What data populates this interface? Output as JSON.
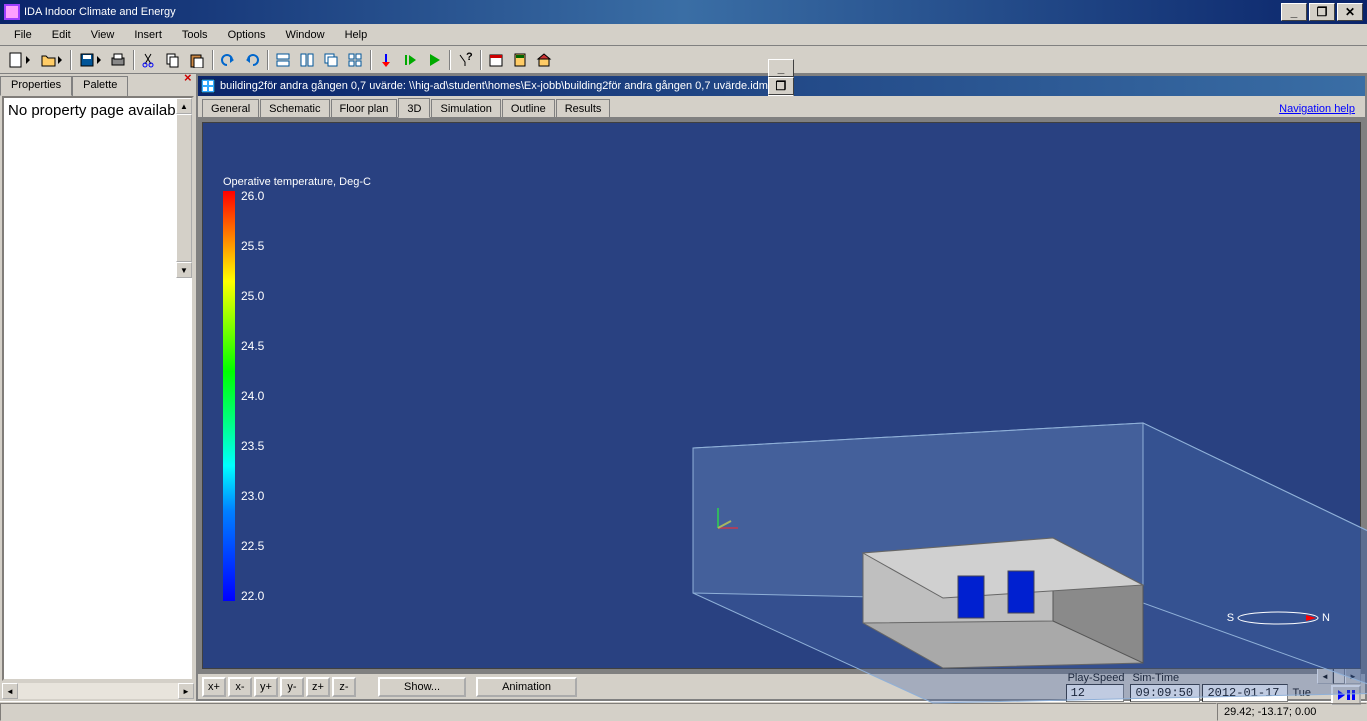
{
  "app": {
    "title": "IDA Indoor Climate and Energy"
  },
  "menu": {
    "file": "File",
    "edit": "Edit",
    "view": "View",
    "insert": "Insert",
    "tools": "Tools",
    "options": "Options",
    "window": "Window",
    "help": "Help"
  },
  "sidebar": {
    "tab_properties": "Properties",
    "tab_palette": "Palette",
    "body": "No property page available"
  },
  "doc": {
    "title": "building2för andra gången 0,7 uvärde: \\\\hig-ad\\student\\homes\\Ex-jobb\\building2för andra gången 0,7 uvärde.idm",
    "tabs": {
      "general": "General",
      "schematic": "Schematic",
      "floorplan": "Floor plan",
      "d3": "3D",
      "simulation": "Simulation",
      "outline": "Outline",
      "results": "Results"
    },
    "navhelp": "Navigation help"
  },
  "legend": {
    "title": "Operative temperature, Deg-C",
    "ticks": [
      "26.0",
      "25.5",
      "25.0",
      "24.5",
      "24.0",
      "23.5",
      "23.0",
      "22.5",
      "22.0"
    ]
  },
  "compass": {
    "s": "S",
    "n": "N"
  },
  "bottom": {
    "xp": "x+",
    "xm": "x-",
    "yp": "y+",
    "ym": "y-",
    "zp": "z+",
    "zm": "z-",
    "show": "Show...",
    "anim": "Animation",
    "playspeed_lbl": "Play-Speed",
    "playspeed": "12",
    "simtime_lbl": "Sim-Time",
    "simtime": "09:09:50",
    "simdate": "2012-01-17",
    "dow": "Tue"
  },
  "status": {
    "coords": "29.42; -13.17; 0.00"
  }
}
